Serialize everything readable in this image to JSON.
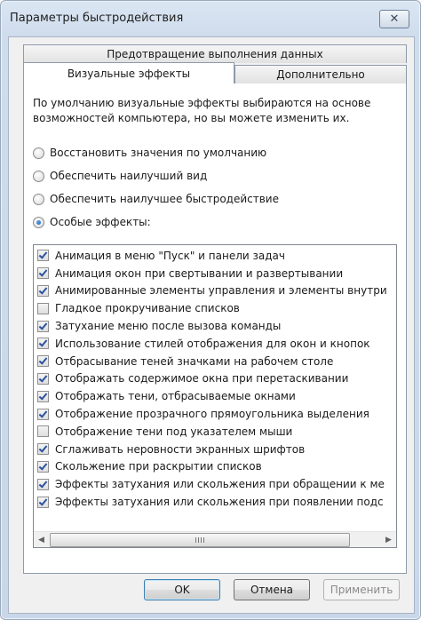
{
  "window": {
    "title": "Параметры быстродействия",
    "close_glyph": "✕"
  },
  "tabs": {
    "back": "Предотвращение выполнения данных",
    "selected": "Визуальные эффекты",
    "right": "Дополнительно"
  },
  "description": "По умолчанию визуальные эффекты выбираются на основе возможностей компьютера, но вы можете изменить их.",
  "radios": [
    {
      "label": "Восстановить значения по умолчанию",
      "selected": false
    },
    {
      "label": "Обеспечить наилучший вид",
      "selected": false
    },
    {
      "label": "Обеспечить наилучшее быстродействие",
      "selected": false
    },
    {
      "label": "Особые эффекты:",
      "selected": true
    }
  ],
  "effects": [
    {
      "label": "Анимация в меню \"Пуск\" и панели задач",
      "checked": true
    },
    {
      "label": "Анимация окон при свертывании и развертывании",
      "checked": true
    },
    {
      "label": "Анимированные элементы управления и элементы внутри",
      "checked": true
    },
    {
      "label": "Гладкое прокручивание списков",
      "checked": false
    },
    {
      "label": "Затухание меню после вызова команды",
      "checked": true
    },
    {
      "label": "Использование стилей отображения для окон и кнопок",
      "checked": true
    },
    {
      "label": "Отбрасывание теней значками на рабочем столе",
      "checked": true
    },
    {
      "label": "Отображать содержимое окна при перетаскивании",
      "checked": true
    },
    {
      "label": "Отображать тени, отбрасываемые окнами",
      "checked": true
    },
    {
      "label": "Отображение прозрачного прямоугольника выделения",
      "checked": true
    },
    {
      "label": "Отображение тени под указателем мыши",
      "checked": false
    },
    {
      "label": "Сглаживать неровности экранных шрифтов",
      "checked": true
    },
    {
      "label": "Скольжение при раскрытии списков",
      "checked": true
    },
    {
      "label": "Эффекты затухания или скольжения при обращении к ме",
      "checked": true
    },
    {
      "label": "Эффекты затухания или скольжения при появлении подс",
      "checked": true
    }
  ],
  "scrollbar": {
    "left_glyph": "◀",
    "right_glyph": "▶"
  },
  "buttons": {
    "ok": "OK",
    "cancel": "Отмена",
    "apply": "Применить"
  }
}
